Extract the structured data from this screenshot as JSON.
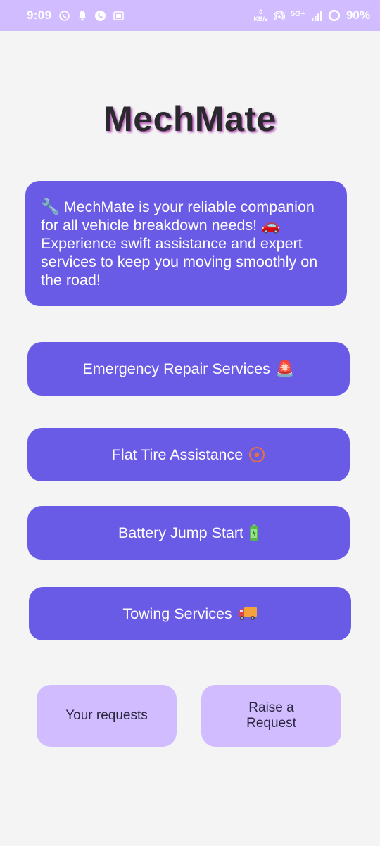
{
  "status_bar": {
    "time": "9:09",
    "net_speed_value": "0",
    "net_speed_unit": "KB/s",
    "network_type": "5G+",
    "battery_percent": "90%",
    "icons": [
      "whatsapp-icon",
      "notification-bell-icon",
      "phone-call-icon",
      "sim-card-icon",
      "hotspot-icon",
      "signal-icon",
      "battery-ring-icon"
    ]
  },
  "app": {
    "title": "MechMate"
  },
  "intro": {
    "text": "🔧 MechMate is your reliable companion for all vehicle breakdown needs! 🚗 Experience swift assistance and expert services to keep you moving smoothly on the road!"
  },
  "services": {
    "emergency_label": "Emergency Repair Services",
    "emergency_emoji": "🚨",
    "flat_tire_label": "Flat Tire Assistance",
    "flat_tire_emoji": "⭕",
    "battery_label": "Battery Jump Start",
    "battery_emoji": "🔋",
    "towing_label": "Towing Services",
    "towing_emoji": "🚚"
  },
  "actions": {
    "your_requests_label": "Your requests",
    "raise_request_label": "Raise a Request"
  },
  "colors": {
    "status_bar_bg": "#d0bcfe",
    "primary_button": "#6a5be6",
    "secondary_button": "#d0bcfe",
    "background": "#f4f4f5",
    "title_shadow": "#b04fb0"
  }
}
